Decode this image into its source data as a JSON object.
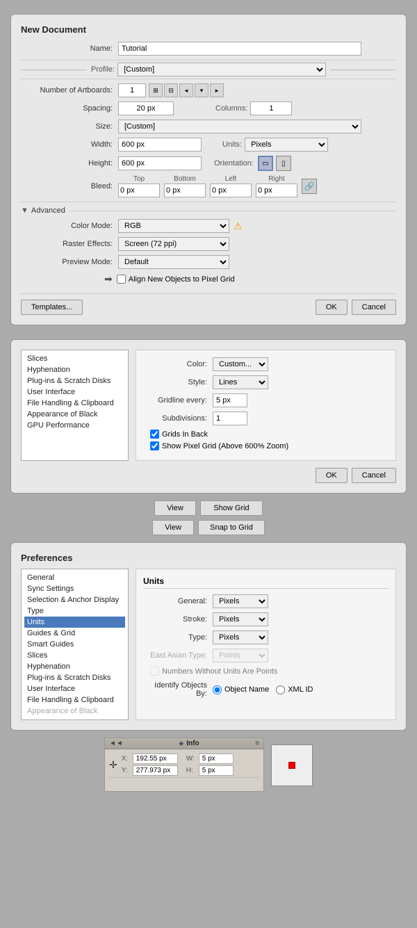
{
  "newDocument": {
    "title": "New Document",
    "nameLabel": "Name:",
    "nameValue": "Tutorial",
    "profileLabel": "Profile:",
    "profileValue": "[Custom]",
    "artboardsLabel": "Number of Artboards:",
    "artboardsValue": "1",
    "spacingLabel": "Spacing:",
    "spacingValue": "20 px",
    "columnsLabel": "Columns:",
    "columnsValue": "1",
    "sizeLabel": "Size:",
    "sizeValue": "[Custom]",
    "widthLabel": "Width:",
    "widthValue": "600 px",
    "unitsLabel": "Units:",
    "unitsValue": "Pixels",
    "heightLabel": "Height:",
    "heightValue": "600 px",
    "orientationLabel": "Orientation:",
    "bleedLabel": "Bleed:",
    "bleedTop": "0 px",
    "bleedBottom": "0 px",
    "bleedLeft": "0 px",
    "bleedRight": "0 px",
    "bleedTopLabel": "Top",
    "bleedBottomLabel": "Bottom",
    "bleedLeftLabel": "Left",
    "bleedRightLabel": "Right",
    "advancedLabel": "Advanced",
    "colorModeLabel": "Color Mode:",
    "colorModeValue": "RGB",
    "rasterLabel": "Raster Effects:",
    "rasterValue": "Screen (72 ppi)",
    "previewLabel": "Preview Mode:",
    "previewValue": "Default",
    "alignCheckbox": "Align New Objects to Pixel Grid",
    "templatesBtn": "Templates...",
    "okBtn": "OK",
    "cancelBtn": "Cancel"
  },
  "guidesGrid": {
    "sidebarItems": [
      "Slices",
      "Hyphenation",
      "Plug-ins & Scratch Disks",
      "User Interface",
      "File Handling & Clipboard",
      "Appearance of Black",
      "GPU Performance"
    ],
    "contentTitle": "",
    "colorLabel": "Color:",
    "colorValue": "Custom...",
    "styleLabel": "Style:",
    "styleValue": "Lines",
    "gridlineLabel": "Gridline every:",
    "gridlineValue": "5 px",
    "subdivisionsLabel": "Subdivisions:",
    "subdivisionsValue": "1",
    "gridsInBackLabel": "Grids In Back",
    "showPixelLabel": "Show Pixel Grid (Above 600% Zoom)",
    "gridsInBackChecked": true,
    "showPixelChecked": true,
    "okBtn": "OK",
    "cancelBtn": "Cancel"
  },
  "gridButtons": [
    {
      "viewLabel": "View",
      "actionLabel": "Show Grid"
    },
    {
      "viewLabel": "View",
      "actionLabel": "Snap to Grid"
    }
  ],
  "preferencesUnits": {
    "title": "Preferences",
    "sidebarItems": [
      {
        "label": "General",
        "active": false
      },
      {
        "label": "Sync Settings",
        "active": false
      },
      {
        "label": "Selection & Anchor Display",
        "active": false
      },
      {
        "label": "Type",
        "active": false
      },
      {
        "label": "Units",
        "active": true
      },
      {
        "label": "Guides & Grid",
        "active": false
      },
      {
        "label": "Smart Guides",
        "active": false
      },
      {
        "label": "Slices",
        "active": false
      },
      {
        "label": "Hyphenation",
        "active": false
      },
      {
        "label": "Plug-ins & Scratch Disks",
        "active": false
      },
      {
        "label": "User Interface",
        "active": false
      },
      {
        "label": "File Handling & Clipboard",
        "active": false
      },
      {
        "label": "Appearance of Black",
        "active": false
      }
    ],
    "unitsTitle": "Units",
    "generalLabel": "General:",
    "generalValue": "Pixels",
    "strokeLabel": "Stroke:",
    "strokeValue": "Pixels",
    "typeLabel": "Type:",
    "typeValue": "Pixels",
    "eastAsianLabel": "East Asian Type:",
    "eastAsianValue": "Points",
    "numbersWithoutUnits": "Numbers Without Units Are Points",
    "identifyLabel": "Identify Objects By:",
    "objectNameLabel": "Object Name",
    "xmlIdLabel": "XML ID"
  },
  "infoPanel": {
    "title": "Info",
    "collapseIcon": "◄◄",
    "menuIcon": "≡",
    "xLabel": "X:",
    "xValue": "192.55 px",
    "yLabel": "Y:",
    "yValue": "277.973 px",
    "wLabel": "W:",
    "wValue": "5 px",
    "hLabel": "H:",
    "hValue": "5 px"
  }
}
